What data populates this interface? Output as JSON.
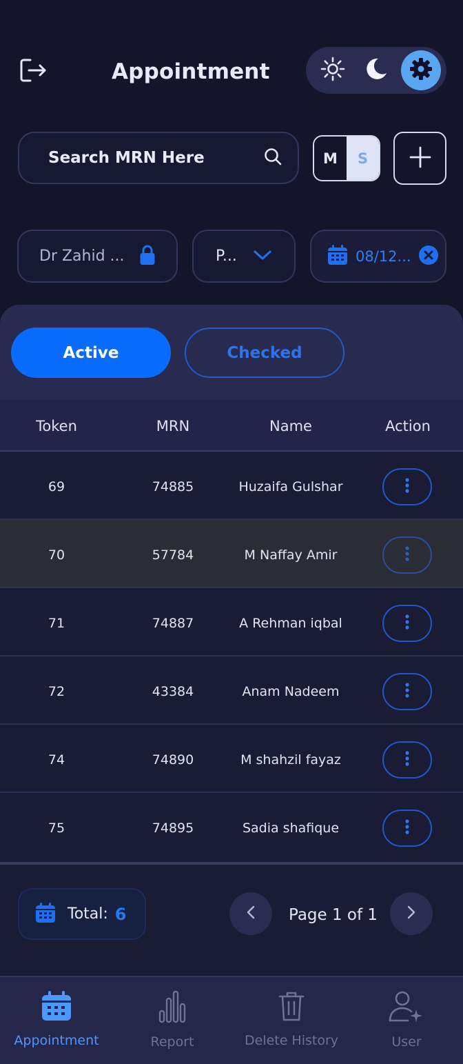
{
  "header": {
    "title": "Appointment",
    "theme_options": [
      "sun-icon",
      "moon-icon",
      "gear-icon"
    ],
    "active_theme": "gear-icon"
  },
  "search": {
    "placeholder": "Search MRN Here",
    "value": ""
  },
  "mode_toggle": {
    "options": [
      "M",
      "S"
    ],
    "selected": "S"
  },
  "filters": {
    "doctor": "Dr Zahid ...",
    "type": "P...",
    "date": "08/12..."
  },
  "tabs": [
    {
      "label": "Active",
      "active": true
    },
    {
      "label": "Checked",
      "active": false
    }
  ],
  "table": {
    "headers": [
      "Token",
      "MRN",
      "Name",
      "Action"
    ],
    "rows": [
      {
        "token": "69",
        "mrn": "74885",
        "name": "Huzaifa Gulshar",
        "highlight": false
      },
      {
        "token": "70",
        "mrn": "57784",
        "name": "M Naffay Amir",
        "highlight": true
      },
      {
        "token": "71",
        "mrn": "74887",
        "name": "A Rehman iqbal",
        "highlight": false
      },
      {
        "token": "72",
        "mrn": "43384",
        "name": "Anam  Nadeem",
        "highlight": false
      },
      {
        "token": "74",
        "mrn": "74890",
        "name": "M shahzil fayaz",
        "highlight": false
      },
      {
        "token": "75",
        "mrn": "74895",
        "name": "Sadia shafique",
        "highlight": false
      }
    ]
  },
  "summary": {
    "total_label": "Total:",
    "total_value": "6",
    "page_info": "Page 1 of 1"
  },
  "bottom_nav": [
    {
      "label": "Appointment",
      "icon": "calendar-icon",
      "active": true
    },
    {
      "label": "Report",
      "icon": "bar-chart-icon",
      "active": false
    },
    {
      "label": "Delete History",
      "icon": "trash-icon",
      "active": false
    },
    {
      "label": "User",
      "icon": "user-icon",
      "active": false
    }
  ],
  "colors": {
    "background": "#14152a",
    "accent": "#0a6cff",
    "highlight_row": "#2a2d35",
    "nav_bar": "#24264a"
  }
}
